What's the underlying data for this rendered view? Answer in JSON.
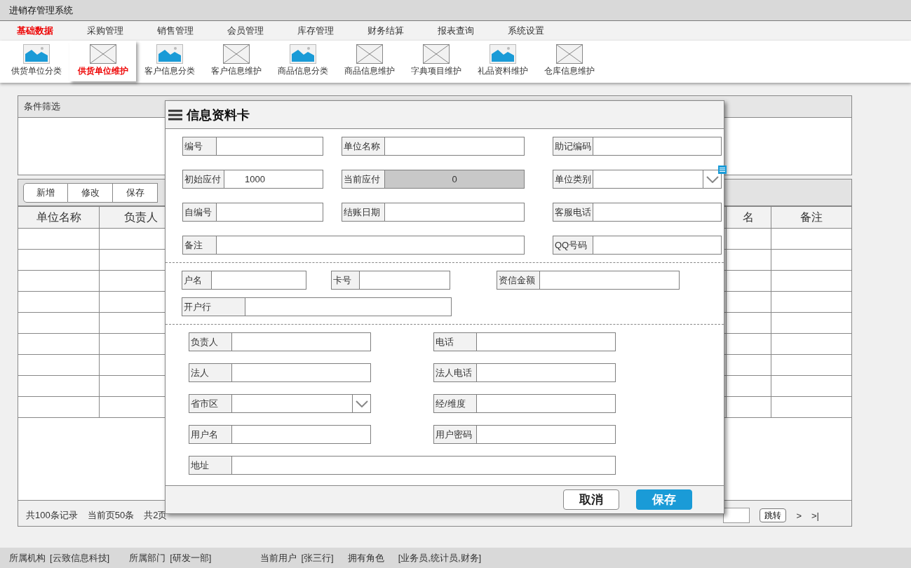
{
  "window": {
    "title": "进销存管理系统"
  },
  "menu": [
    {
      "label": "基础数据",
      "selected": true
    },
    {
      "label": "采购管理",
      "selected": false
    },
    {
      "label": "销售管理",
      "selected": false
    },
    {
      "label": "会员管理",
      "selected": false
    },
    {
      "label": "库存管理",
      "selected": false
    },
    {
      "label": "财务结算",
      "selected": false
    },
    {
      "label": "报表查询",
      "selected": false
    },
    {
      "label": "系统设置",
      "selected": false
    }
  ],
  "toolbar": [
    {
      "label": "供货单位分类",
      "kind": "image",
      "selected": false
    },
    {
      "label": "供货单位维护",
      "kind": "placeholder",
      "selected": true
    },
    {
      "label": "客户信息分类",
      "kind": "image",
      "selected": false
    },
    {
      "label": "客户信息维护",
      "kind": "placeholder",
      "selected": false
    },
    {
      "label": "商品信息分类",
      "kind": "image",
      "selected": false
    },
    {
      "label": "商品信息维护",
      "kind": "placeholder",
      "selected": false
    },
    {
      "label": "字典项目维护",
      "kind": "placeholder",
      "selected": false
    },
    {
      "label": "礼品资料维护",
      "kind": "image",
      "selected": false
    },
    {
      "label": "仓库信息维护",
      "kind": "placeholder",
      "selected": false
    }
  ],
  "filter_panel": {
    "title": "条件筛选"
  },
  "actions": [
    "新增",
    "修改",
    "保存"
  ],
  "table": {
    "columns": [
      "单位名称",
      "负责人",
      "",
      "名",
      "备注"
    ]
  },
  "pagination": {
    "total": "共100条记录",
    "page_size": "当前页50条",
    "pages": "共2页",
    "jump": "跳转",
    "next": ">",
    "last": ">|"
  },
  "dialog": {
    "title": "信息资料卡",
    "sections": [
      {
        "rows": [
          [
            {
              "label": "编号",
              "kind": "text"
            },
            {
              "label": "单位名称",
              "kind": "text"
            },
            {
              "label": "助记编码",
              "kind": "text"
            }
          ],
          [
            {
              "label": "初始应付",
              "kind": "text",
              "value": "1000"
            },
            {
              "label": "当前应付",
              "kind": "readonly",
              "value": "0"
            },
            {
              "label": "单位类别",
              "kind": "select"
            }
          ],
          [
            {
              "label": "自编号",
              "kind": "text"
            },
            {
              "label": "结账日期",
              "kind": "text"
            },
            {
              "label": "客服电话",
              "kind": "text"
            }
          ],
          [
            {
              "label": "备注",
              "kind": "text"
            },
            "",
            {
              "label": "QQ号码",
              "kind": "text"
            }
          ]
        ]
      },
      {
        "rows": [
          [
            {
              "label": "户名",
              "kind": "text"
            },
            {
              "label": "卡号",
              "kind": "text"
            },
            {
              "label": "资信金额",
              "kind": "text"
            }
          ],
          [
            {
              "label": "开户行",
              "kind": "text"
            }
          ]
        ]
      },
      {
        "rows": [
          [
            {
              "label": "负责人",
              "kind": "text"
            },
            {
              "label": "电话",
              "kind": "text"
            }
          ],
          [
            {
              "label": "法人",
              "kind": "text"
            },
            {
              "label": "法人电话",
              "kind": "text"
            }
          ],
          [
            {
              "label": "省市区",
              "kind": "select"
            },
            {
              "label": "经/维度",
              "kind": "text"
            }
          ],
          [
            {
              "label": "用户名",
              "kind": "text"
            },
            {
              "label": "用户密码",
              "kind": "text"
            }
          ],
          [
            {
              "label": "地址",
              "kind": "text"
            }
          ]
        ]
      }
    ],
    "buttons": [
      {
        "label": "取消",
        "kind": "secondary"
      },
      {
        "label": "保存",
        "kind": "primary"
      }
    ]
  },
  "status_bar": [
    {
      "label": "所属机构",
      "value": "[云致信息科技]"
    },
    {
      "label": "所属部门",
      "value": "[研发一部]"
    },
    {
      "label": "当前用户",
      "value": "[张三行]"
    },
    {
      "label": "拥有角色",
      "value": "[业务员,统计员,财务]"
    }
  ]
}
